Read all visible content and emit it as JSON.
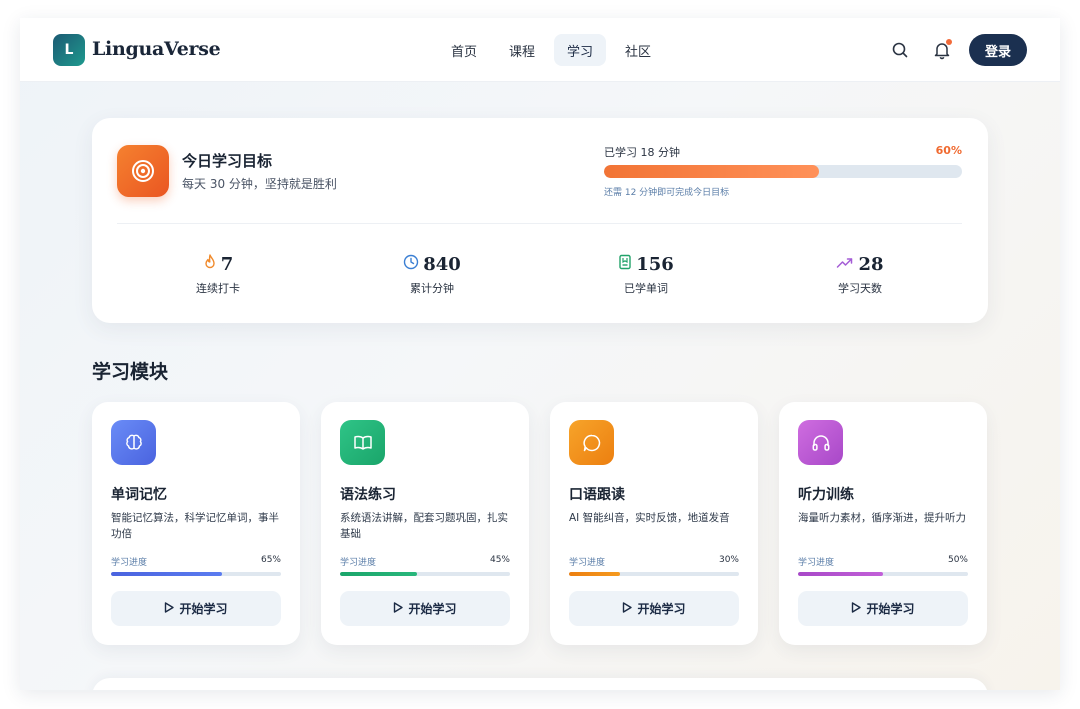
{
  "app": {
    "logo_letter": "L",
    "name": "LinguaVerse"
  },
  "nav": {
    "items": [
      {
        "label": "首页",
        "active": false
      },
      {
        "label": "课程",
        "active": false
      },
      {
        "label": "学习",
        "active": true
      },
      {
        "label": "社区",
        "active": false
      }
    ],
    "search_icon": "search-icon",
    "bell_icon": "bell-icon",
    "login_label": "登录"
  },
  "goal": {
    "title": "今日学习目标",
    "subtitle": "每天 30 分钟，坚持就是胜利",
    "learned": "已学习 18 分钟",
    "percent_label": "60%",
    "progress": 0.6,
    "remaining": "还需 12 分钟即可完成今日目标",
    "icon": "target-icon",
    "stats": [
      {
        "value": "7",
        "label": "连续打卡",
        "icon": "flame-icon",
        "color": "#f08a2c"
      },
      {
        "value": "840",
        "label": "累计分钟",
        "icon": "clock-icon",
        "color": "#3b7fd3"
      },
      {
        "value": "156",
        "label": "已学单词",
        "icon": "book-icon",
        "color": "#22a36a"
      },
      {
        "value": "28",
        "label": "学习天数",
        "icon": "trending-up-icon",
        "color": "#a45cd6"
      }
    ]
  },
  "section_title": "学习模块",
  "modules": [
    {
      "title": "单词记忆",
      "desc": "智能记忆算法，科学记忆单词，事半功倍",
      "progress_label": "学习进度",
      "progress_text": "65%",
      "progress": 0.65,
      "button": "开始学习",
      "icon": "brain-icon",
      "color": "#5b7cf0",
      "color2": "#4a63df"
    },
    {
      "title": "语法练习",
      "desc": "系统语法讲解，配套习题巩固，扎实基础",
      "progress_label": "学习进度",
      "progress_text": "45%",
      "progress": 0.45,
      "button": "开始学习",
      "icon": "open-book-icon",
      "color": "#29b77c",
      "color2": "#1aa56a"
    },
    {
      "title": "口语跟读",
      "desc": "AI 智能纠音，实时反馈，地道发音",
      "progress_label": "学习进度",
      "progress_text": "30%",
      "progress": 0.3,
      "button": "开始学习",
      "icon": "chat-icon",
      "color": "#f59a1e",
      "color2": "#ec7f10"
    },
    {
      "title": "听力训练",
      "desc": "海量听力素材，循序渐进，提升听力",
      "progress_label": "学习进度",
      "progress_text": "50%",
      "progress": 0.5,
      "button": "开始学习",
      "icon": "headphones-icon",
      "color": "#c260d8",
      "color2": "#a848c8"
    }
  ]
}
